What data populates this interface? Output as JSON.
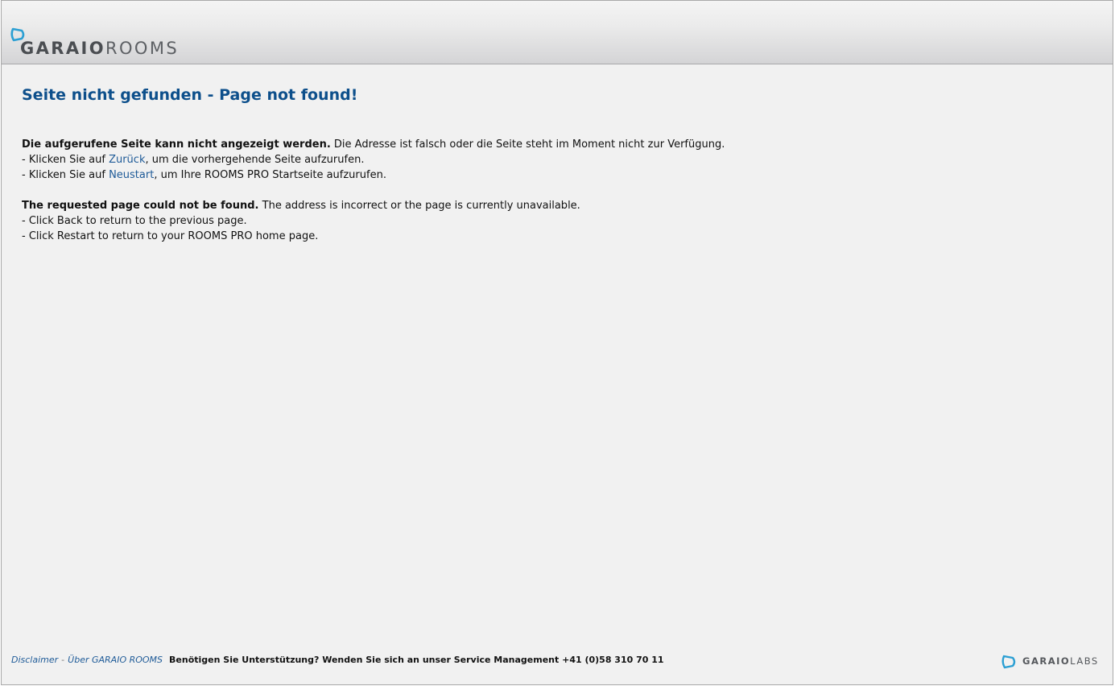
{
  "header": {
    "logo": {
      "bold": "GARAIO",
      "light": "ROOMS"
    }
  },
  "main": {
    "title": "Seite nicht gefunden - Page not found!",
    "german": {
      "lead_bold": "Die aufgerufene Seite kann nicht angezeigt werden.",
      "lead_rest": " Die Adresse ist falsch oder die Seite steht im Moment nicht zur Verfügung.",
      "line1_pre": "- Klicken Sie auf ",
      "line1_link": "Zurück",
      "line1_post": ", um die vorhergehende Seite aufzurufen.",
      "line2_pre": "- Klicken Sie auf ",
      "line2_link": "Neustart",
      "line2_post": ", um Ihre ROOMS PRO Startseite aufzurufen."
    },
    "english": {
      "lead_bold": "The requested page could not be found.",
      "lead_rest": " The address is incorrect or the page is currently unavailable.",
      "line1": "- Click Back to return to the previous page.",
      "line2": "- Click Restart to return to your ROOMS PRO home page."
    }
  },
  "footer": {
    "disclaimer": "Disclaimer",
    "separator": "-",
    "about": "Über GARAIO ROOMS",
    "support": "Benötigen Sie Unterstützung? Wenden Sie sich an unser Service Management +41 (0)58 310 70 11",
    "labs_logo": {
      "bold": "GARAIO",
      "light": "LABS"
    }
  },
  "colors": {
    "accent": "#0d4f8b",
    "link": "#1f5b98",
    "logo_ring": "#2b9fd3",
    "background": "#f1f1f1"
  }
}
